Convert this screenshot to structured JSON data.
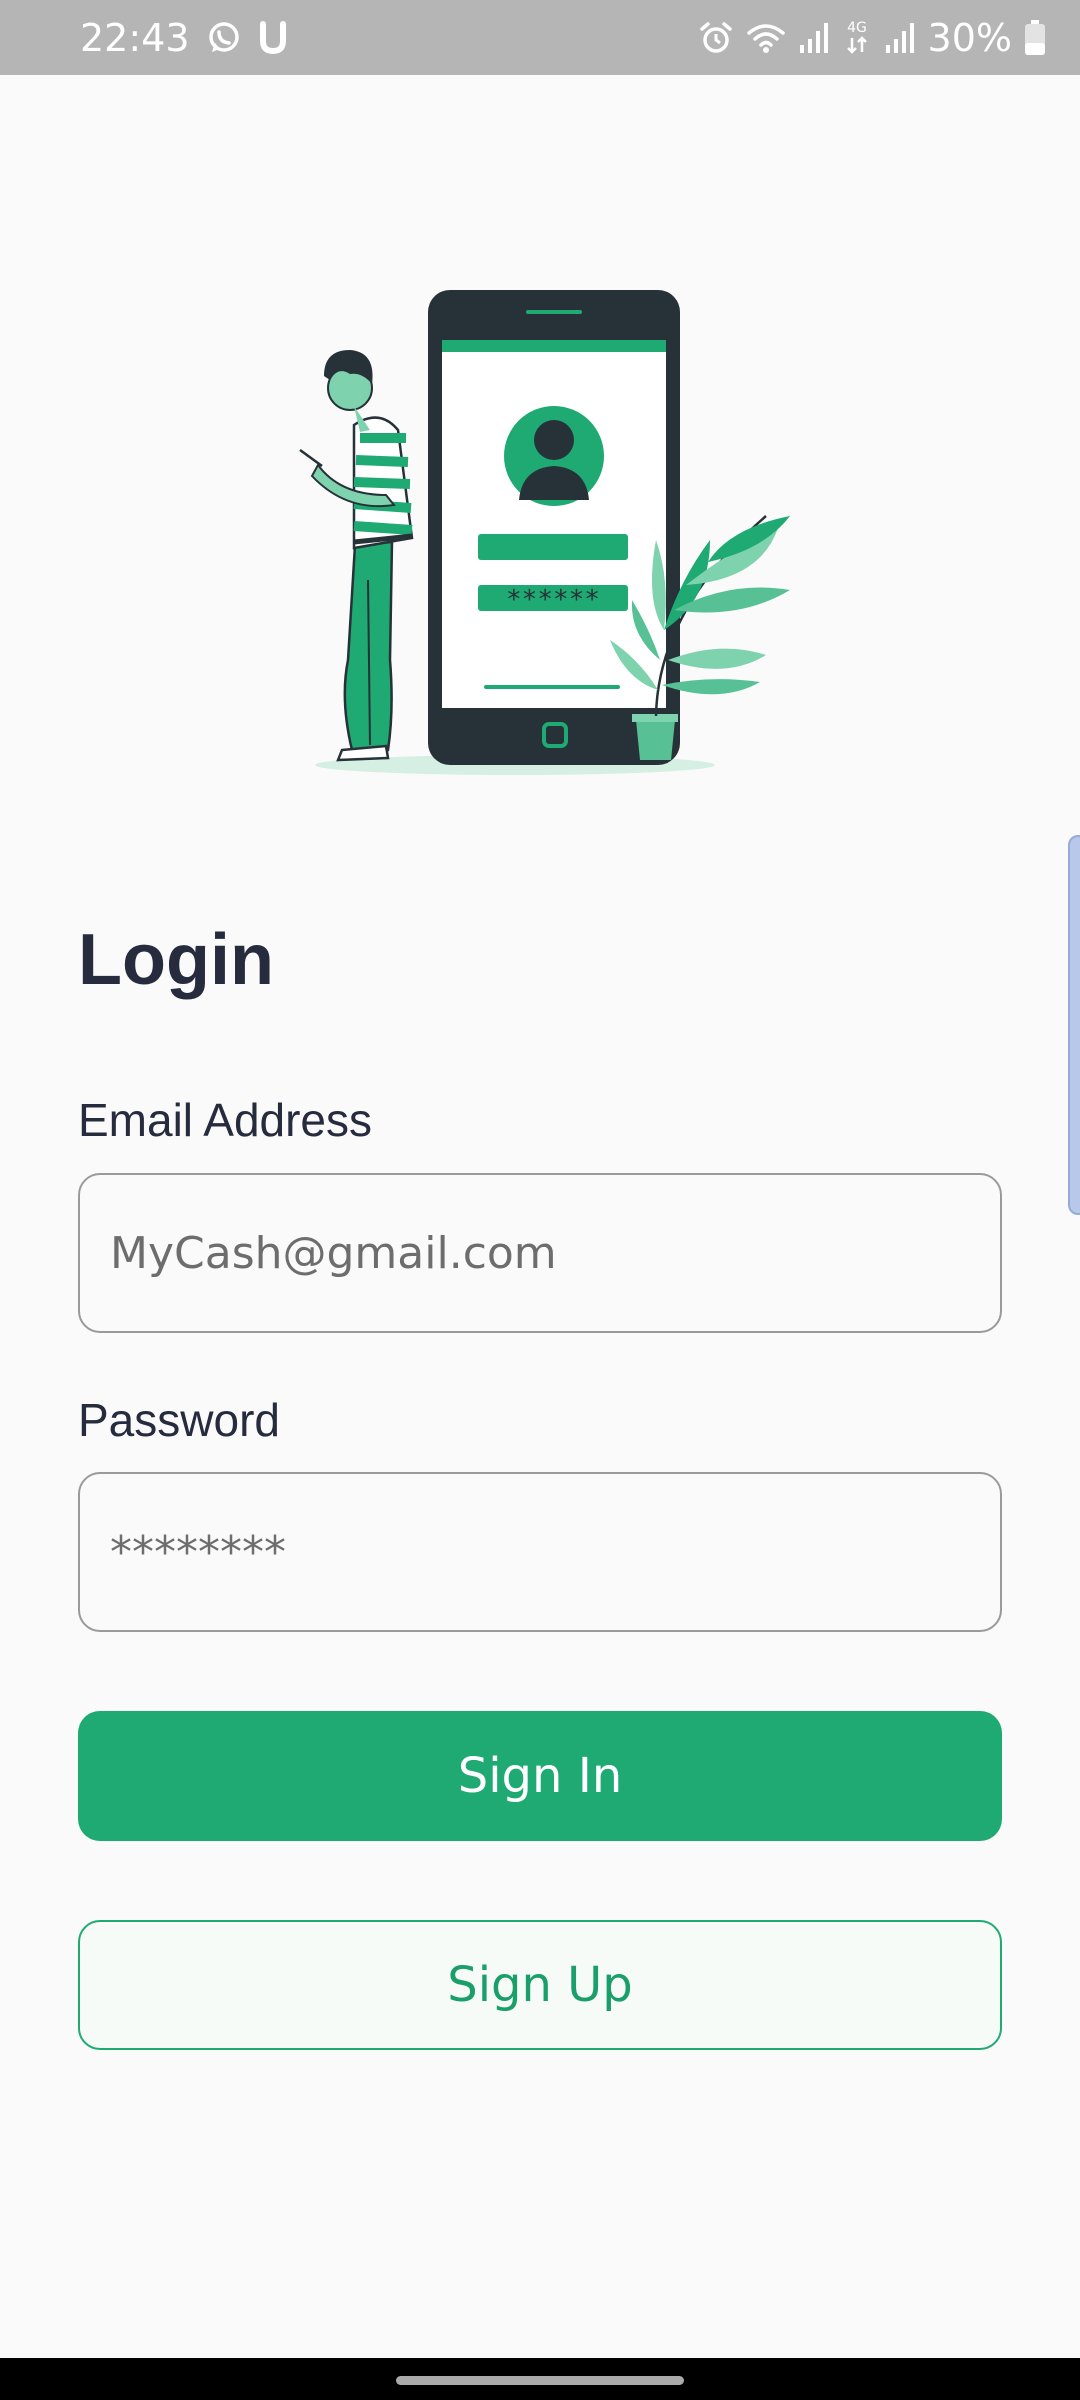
{
  "status_bar": {
    "time": "22:43",
    "battery_percent": "30%",
    "left_icons": [
      "whatsapp-icon",
      "u-app-icon"
    ],
    "right_icons": [
      "alarm-icon",
      "wifi-icon",
      "signal-icon",
      "4g-icon",
      "signal-icon",
      "battery-icon"
    ],
    "network_type": "4G"
  },
  "illustration": {
    "password_mask": "******",
    "accent_color": "#1eaa72",
    "dark_color": "#263238"
  },
  "login": {
    "title": "Login",
    "email_label": "Email Address",
    "email_placeholder": "MyCash@gmail.com",
    "password_label": "Password",
    "password_placeholder": "********",
    "sign_in_label": "Sign In",
    "sign_up_label": "Sign Up"
  },
  "colors": {
    "primary": "#1eaa72",
    "text": "#262b3d",
    "background": "#fafafa"
  }
}
